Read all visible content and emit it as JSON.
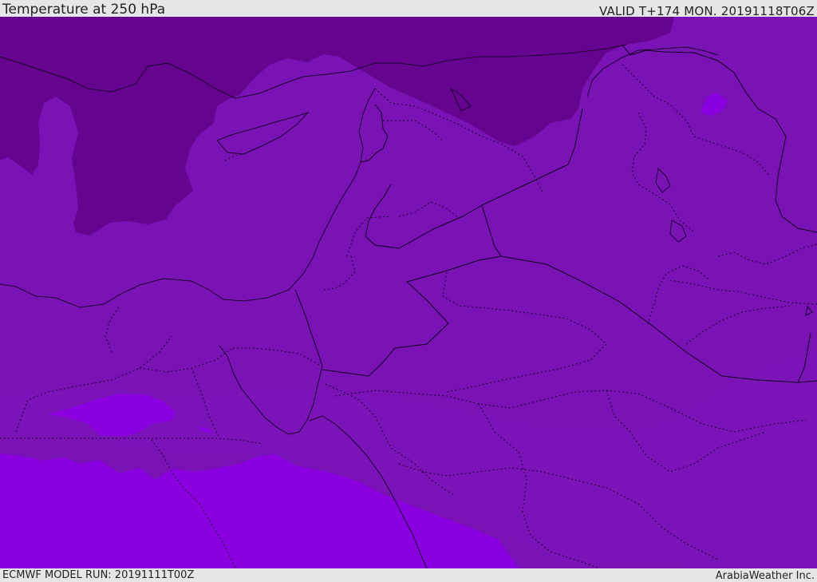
{
  "header": {
    "title": "Temperature at 250 hPa",
    "valid": "VALID T+174 MON. 20191118T06Z"
  },
  "footer": {
    "model_run": "ECMWF MODEL RUN: 20191111T00Z",
    "credit": "ArabiaWeather Inc."
  },
  "colors": {
    "cold_band": "#65048f",
    "base_band": "#7a12b6",
    "mid_band": "#7d10b9",
    "warm_band": "#8a00e0",
    "coastline": "#1b0030",
    "border": "#10001e"
  }
}
